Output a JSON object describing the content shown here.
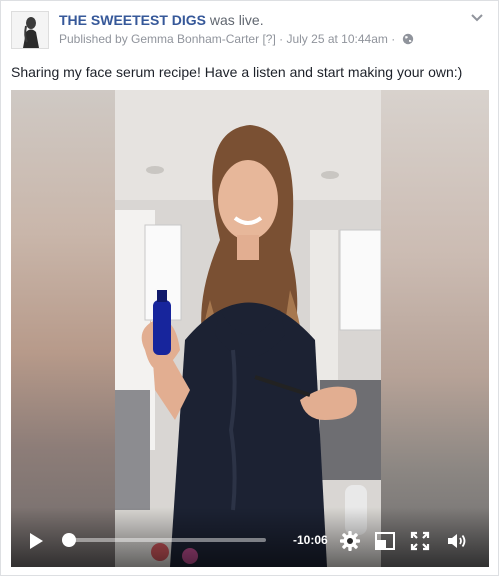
{
  "post": {
    "page_name": "THE SWEETEST DIGS",
    "status": "was live.",
    "published_by": "Published by Gemma Bonham-Carter",
    "help_marker": "[?]",
    "separator": "·",
    "timestamp": "July 25 at 10:44am",
    "text": "Sharing my face serum recipe! Have a listen and start making your own:)",
    "privacy_icon": "globe-icon",
    "options_icon": "chevron-down-icon"
  },
  "video": {
    "time_remaining": "-10:06",
    "progress": 0.03,
    "controls": {
      "play_icon": "play-icon",
      "settings_icon": "gear-icon",
      "pip_icon": "picture-in-picture-icon",
      "fullscreen_icon": "fullscreen-icon",
      "volume_icon": "volume-icon"
    }
  },
  "colors": {
    "link": "#365899",
    "meta": "#90949c",
    "text": "#1d2129"
  }
}
